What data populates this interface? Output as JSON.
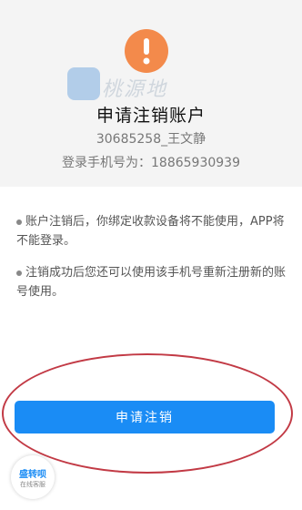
{
  "header": {
    "title": "申请注销账户",
    "account": "30685258_王文静",
    "phone": "登录手机号为：18865930939"
  },
  "watermark": {
    "text": "桃源地",
    "badge_main": "盛转呗",
    "badge_sub": "在线客服"
  },
  "notes": [
    "账户注销后，你绑定收款设备将不能使用，APP将不能登录。",
    "注销成功后您还可以使用该手机号重新注册新的账号使用。"
  ],
  "action": {
    "label": "申请注销"
  },
  "colors": {
    "accent": "#1a8cf5",
    "warning": "#f38a4b",
    "highlight": "#c23a45"
  },
  "icons": {
    "warning": "exclamation-circle-icon"
  }
}
